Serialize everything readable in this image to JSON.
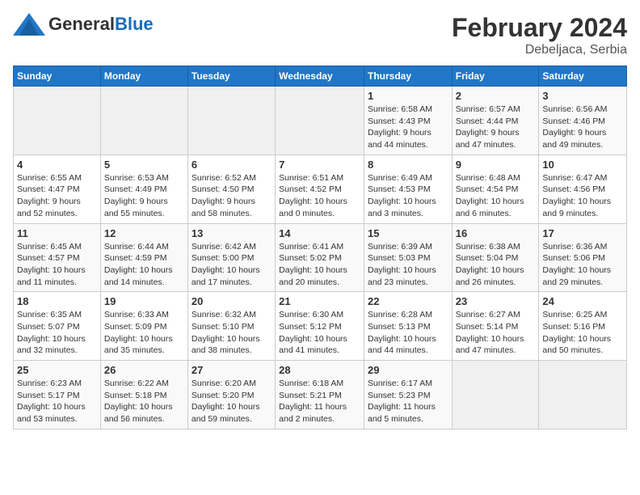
{
  "header": {
    "logo_general": "General",
    "logo_blue": "Blue",
    "title": "February 2024",
    "subtitle": "Debeljaca, Serbia"
  },
  "weekdays": [
    "Sunday",
    "Monday",
    "Tuesday",
    "Wednesday",
    "Thursday",
    "Friday",
    "Saturday"
  ],
  "weeks": [
    [
      {
        "day": "",
        "info": ""
      },
      {
        "day": "",
        "info": ""
      },
      {
        "day": "",
        "info": ""
      },
      {
        "day": "",
        "info": ""
      },
      {
        "day": "1",
        "info": "Sunrise: 6:58 AM\nSunset: 4:43 PM\nDaylight: 9 hours\nand 44 minutes."
      },
      {
        "day": "2",
        "info": "Sunrise: 6:57 AM\nSunset: 4:44 PM\nDaylight: 9 hours\nand 47 minutes."
      },
      {
        "day": "3",
        "info": "Sunrise: 6:56 AM\nSunset: 4:46 PM\nDaylight: 9 hours\nand 49 minutes."
      }
    ],
    [
      {
        "day": "4",
        "info": "Sunrise: 6:55 AM\nSunset: 4:47 PM\nDaylight: 9 hours\nand 52 minutes."
      },
      {
        "day": "5",
        "info": "Sunrise: 6:53 AM\nSunset: 4:49 PM\nDaylight: 9 hours\nand 55 minutes."
      },
      {
        "day": "6",
        "info": "Sunrise: 6:52 AM\nSunset: 4:50 PM\nDaylight: 9 hours\nand 58 minutes."
      },
      {
        "day": "7",
        "info": "Sunrise: 6:51 AM\nSunset: 4:52 PM\nDaylight: 10 hours\nand 0 minutes."
      },
      {
        "day": "8",
        "info": "Sunrise: 6:49 AM\nSunset: 4:53 PM\nDaylight: 10 hours\nand 3 minutes."
      },
      {
        "day": "9",
        "info": "Sunrise: 6:48 AM\nSunset: 4:54 PM\nDaylight: 10 hours\nand 6 minutes."
      },
      {
        "day": "10",
        "info": "Sunrise: 6:47 AM\nSunset: 4:56 PM\nDaylight: 10 hours\nand 9 minutes."
      }
    ],
    [
      {
        "day": "11",
        "info": "Sunrise: 6:45 AM\nSunset: 4:57 PM\nDaylight: 10 hours\nand 11 minutes."
      },
      {
        "day": "12",
        "info": "Sunrise: 6:44 AM\nSunset: 4:59 PM\nDaylight: 10 hours\nand 14 minutes."
      },
      {
        "day": "13",
        "info": "Sunrise: 6:42 AM\nSunset: 5:00 PM\nDaylight: 10 hours\nand 17 minutes."
      },
      {
        "day": "14",
        "info": "Sunrise: 6:41 AM\nSunset: 5:02 PM\nDaylight: 10 hours\nand 20 minutes."
      },
      {
        "day": "15",
        "info": "Sunrise: 6:39 AM\nSunset: 5:03 PM\nDaylight: 10 hours\nand 23 minutes."
      },
      {
        "day": "16",
        "info": "Sunrise: 6:38 AM\nSunset: 5:04 PM\nDaylight: 10 hours\nand 26 minutes."
      },
      {
        "day": "17",
        "info": "Sunrise: 6:36 AM\nSunset: 5:06 PM\nDaylight: 10 hours\nand 29 minutes."
      }
    ],
    [
      {
        "day": "18",
        "info": "Sunrise: 6:35 AM\nSunset: 5:07 PM\nDaylight: 10 hours\nand 32 minutes."
      },
      {
        "day": "19",
        "info": "Sunrise: 6:33 AM\nSunset: 5:09 PM\nDaylight: 10 hours\nand 35 minutes."
      },
      {
        "day": "20",
        "info": "Sunrise: 6:32 AM\nSunset: 5:10 PM\nDaylight: 10 hours\nand 38 minutes."
      },
      {
        "day": "21",
        "info": "Sunrise: 6:30 AM\nSunset: 5:12 PM\nDaylight: 10 hours\nand 41 minutes."
      },
      {
        "day": "22",
        "info": "Sunrise: 6:28 AM\nSunset: 5:13 PM\nDaylight: 10 hours\nand 44 minutes."
      },
      {
        "day": "23",
        "info": "Sunrise: 6:27 AM\nSunset: 5:14 PM\nDaylight: 10 hours\nand 47 minutes."
      },
      {
        "day": "24",
        "info": "Sunrise: 6:25 AM\nSunset: 5:16 PM\nDaylight: 10 hours\nand 50 minutes."
      }
    ],
    [
      {
        "day": "25",
        "info": "Sunrise: 6:23 AM\nSunset: 5:17 PM\nDaylight: 10 hours\nand 53 minutes."
      },
      {
        "day": "26",
        "info": "Sunrise: 6:22 AM\nSunset: 5:18 PM\nDaylight: 10 hours\nand 56 minutes."
      },
      {
        "day": "27",
        "info": "Sunrise: 6:20 AM\nSunset: 5:20 PM\nDaylight: 10 hours\nand 59 minutes."
      },
      {
        "day": "28",
        "info": "Sunrise: 6:18 AM\nSunset: 5:21 PM\nDaylight: 11 hours\nand 2 minutes."
      },
      {
        "day": "29",
        "info": "Sunrise: 6:17 AM\nSunset: 5:23 PM\nDaylight: 11 hours\nand 5 minutes."
      },
      {
        "day": "",
        "info": ""
      },
      {
        "day": "",
        "info": ""
      }
    ]
  ]
}
